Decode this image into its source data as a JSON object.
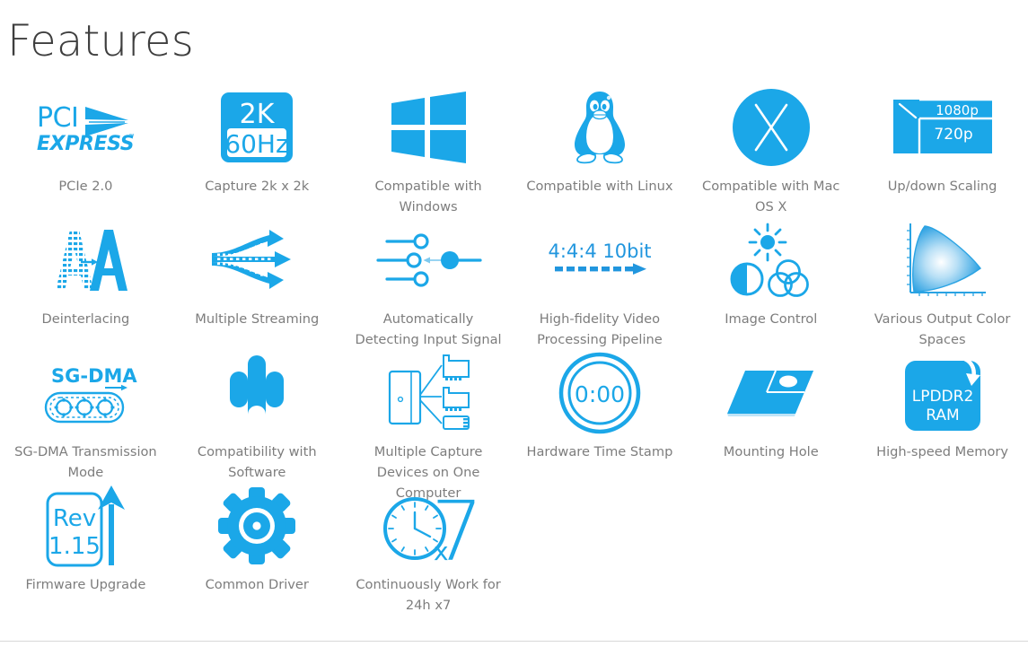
{
  "page": {
    "title": "Features",
    "accent_color": "#1BA7E8",
    "accent_dark": "#1B8FD4",
    "label_color": "#7d7d7d",
    "title_color": "#3e3e3e",
    "background": "#ffffff",
    "divider_color": "#d8d8d8"
  },
  "features": [
    {
      "id": "pcie",
      "icon": "pci-express-logo-icon",
      "label": "PCIe 2.0",
      "icon_text": [
        "PCI",
        "EXPRESS"
      ]
    },
    {
      "id": "capture2k",
      "icon": "capture-2k-60hz-badge-icon",
      "label": "Capture 2k x 2k",
      "icon_text": [
        "2K",
        "60Hz"
      ]
    },
    {
      "id": "windows",
      "icon": "windows-logo-icon",
      "label": "Compatible with Windows",
      "icon_text": []
    },
    {
      "id": "linux",
      "icon": "linux-tux-penguin-icon",
      "label": "Compatible with Linux",
      "icon_text": []
    },
    {
      "id": "macos",
      "icon": "mac-os-x-circle-icon",
      "label": "Compatible with Mac OS X",
      "icon_text": [
        "X"
      ]
    },
    {
      "id": "scaling",
      "icon": "up-down-scaling-icon",
      "label": "Up/down Scaling",
      "icon_text": [
        "1080p",
        "720p"
      ]
    },
    {
      "id": "deinterlacing",
      "icon": "deinterlacing-a-to-a-icon",
      "label": "Deinterlacing",
      "icon_text": [
        "A",
        "A"
      ]
    },
    {
      "id": "multistream",
      "icon": "multiple-streaming-arrows-icon",
      "label": "Multiple Streaming",
      "icon_text": []
    },
    {
      "id": "autodetect",
      "icon": "auto-detect-signal-sliders-icon",
      "label": "Automatically Detecting Input Signal",
      "icon_text": []
    },
    {
      "id": "hifivideo",
      "icon": "high-fidelity-444-10bit-icon",
      "label": "High-fidelity Video Processing Pipeline",
      "icon_text": [
        "4:4:4 10bit"
      ]
    },
    {
      "id": "imagecontrol",
      "icon": "image-control-sun-contrast-icon",
      "label": "Image Control",
      "icon_text": []
    },
    {
      "id": "colorspaces",
      "icon": "cie-color-gamut-icon",
      "label": "Various Output Color Spaces",
      "icon_text": []
    },
    {
      "id": "sgdma",
      "icon": "sg-dma-conveyor-gears-icon",
      "label": "SG-DMA Transmission Mode",
      "icon_text": [
        "SG-DMA"
      ]
    },
    {
      "id": "software",
      "icon": "puzzle-piece-icon",
      "label": "Compatibility with Software",
      "icon_text": []
    },
    {
      "id": "multidevice",
      "icon": "multiple-capture-devices-icon",
      "label": "Multiple Capture Devices on One Computer",
      "icon_text": []
    },
    {
      "id": "timestamp",
      "icon": "hardware-timer-clock-icon",
      "label": "Hardware Time Stamp",
      "icon_text": [
        "0:00"
      ]
    },
    {
      "id": "mountinghole",
      "icon": "mounting-hole-plate-icon",
      "label": "Mounting Hole",
      "icon_text": []
    },
    {
      "id": "memory",
      "icon": "lpddr2-ram-chip-icon",
      "label": "High-speed Memory",
      "icon_text": [
        "LPDDR2",
        "RAM"
      ]
    },
    {
      "id": "firmware",
      "icon": "firmware-upgrade-rev-icon",
      "label": "Firmware Upgrade",
      "icon_text": [
        "Rev",
        "1.15"
      ]
    },
    {
      "id": "driver",
      "icon": "gear-common-driver-icon",
      "label": "Common Driver",
      "icon_text": []
    },
    {
      "id": "continuous",
      "icon": "clock-24h-x7-icon",
      "label": "Continuously Work for 24h x7",
      "icon_text": [
        "x7",
        "7"
      ]
    }
  ]
}
